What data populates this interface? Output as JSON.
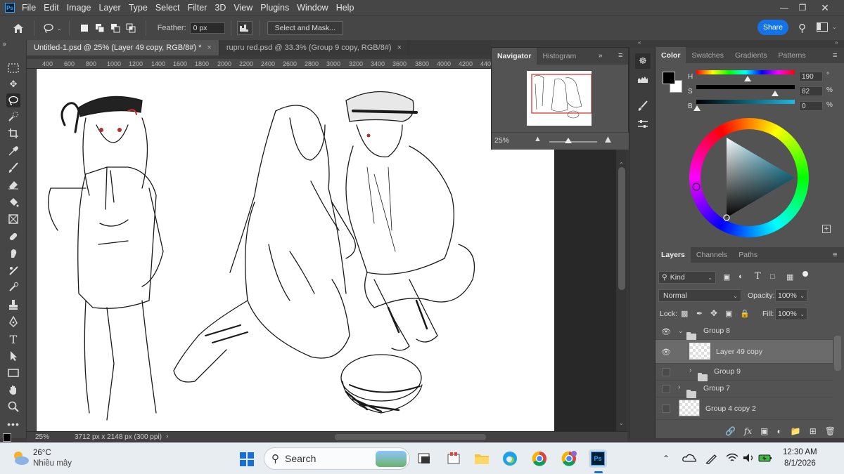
{
  "menu": {
    "logo": "Ps",
    "items": [
      "File",
      "Edit",
      "Image",
      "Layer",
      "Type",
      "Select",
      "Filter",
      "3D",
      "View",
      "Plugins",
      "Window",
      "Help"
    ]
  },
  "options": {
    "feather_label": "Feather:",
    "feather_value": "0 px",
    "select_mask": "Select and Mask...",
    "share": "Share"
  },
  "tabs": [
    {
      "label": "Untitled-1.psd @ 25% (Layer 49 copy, RGB/8#) *",
      "active": true
    },
    {
      "label": "rupru red.psd @ 33.3% (Group 9 copy, RGB/8#)",
      "active": false
    }
  ],
  "ruler": [
    "400",
    "600",
    "800",
    "1000",
    "1200",
    "1400",
    "1600",
    "1800",
    "2000",
    "2200",
    "2400",
    "2600",
    "2800",
    "3000",
    "3200",
    "3400",
    "3600",
    "3800",
    "4000",
    "4200",
    "440"
  ],
  "status": {
    "zoom": "25%",
    "doc_size": "3712 px x 2148 px (300 ppi)"
  },
  "navigator": {
    "tabs": [
      "Navigator",
      "Histogram"
    ],
    "zoom": "25%"
  },
  "color_panel": {
    "tabs": [
      "Color",
      "Swatches",
      "Gradients",
      "Patterns"
    ],
    "h_label": "H",
    "h_value": "190",
    "h_unit": "°",
    "s_label": "S",
    "s_value": "82",
    "s_unit": "%",
    "b_label": "B",
    "b_value": "0",
    "b_unit": "%",
    "foreground": "#000000",
    "background": "#ffffff"
  },
  "layers_panel": {
    "tabs": [
      "Layers",
      "Channels",
      "Paths"
    ],
    "filter": "Kind",
    "blend": "Normal",
    "opacity_label": "Opacity:",
    "opacity": "100%",
    "lock_label": "Lock:",
    "fill_label": "Fill:",
    "fill": "100%",
    "layers": [
      {
        "name": "Group 8",
        "type": "group",
        "visible": true,
        "expanded": true,
        "indent": 0
      },
      {
        "name": "Layer 49 copy",
        "type": "layer",
        "visible": true,
        "selected": true,
        "indent": 1
      },
      {
        "name": "Group 9",
        "type": "group",
        "visible": false,
        "expanded": false,
        "indent": 1
      },
      {
        "name": "Group 7",
        "type": "group",
        "visible": false,
        "expanded": false,
        "indent": 0
      },
      {
        "name": "Group 4 copy 2",
        "type": "layer",
        "visible": false,
        "indent": 0
      }
    ]
  },
  "taskbar": {
    "weather_temp": "26°C",
    "weather_desc": "Nhiều mây",
    "search_placeholder": "Search",
    "time": "12:30 AM",
    "date": "8/1/2026"
  }
}
